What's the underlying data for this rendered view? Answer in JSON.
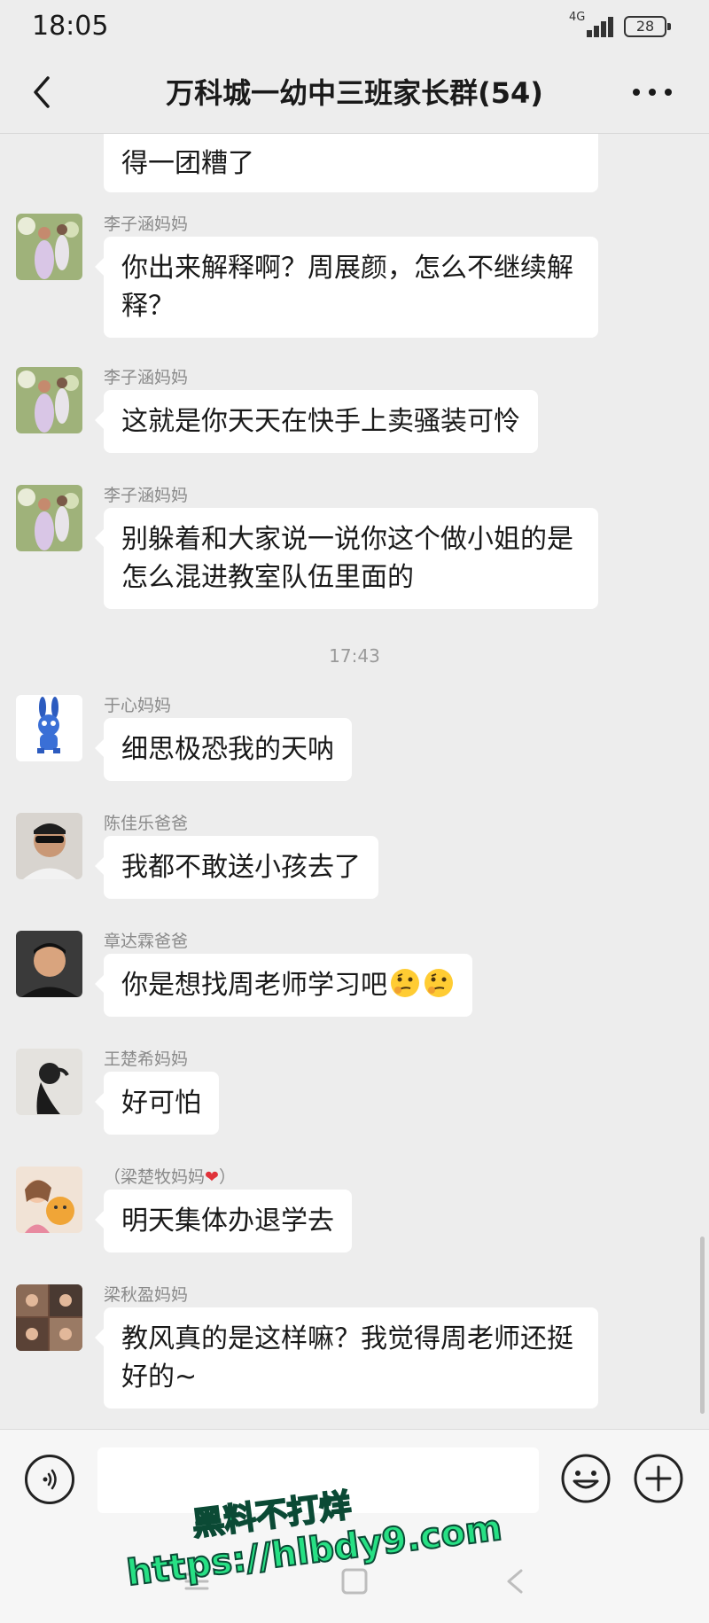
{
  "status_bar": {
    "time": "18:05",
    "network": "4G",
    "battery": "28"
  },
  "header": {
    "title": "万科城一幼中三班家长群(54)",
    "back_icon": "chevron-left-icon",
    "more_icon": "more-horizontal-icon"
  },
  "messages": [
    {
      "text": "得一团糟了"
    },
    {
      "sender": "李子涵妈妈",
      "text": "你出来解释啊？周展颜，怎么不继续解释？"
    },
    {
      "sender": "李子涵妈妈",
      "text": "这就是你天天在快手上卖骚装可怜"
    },
    {
      "sender": "李子涵妈妈",
      "text": "别躲着和大家说一说你这个做小姐的是怎么混进教室队伍里面的"
    },
    {
      "timestamp": "17:43"
    },
    {
      "sender": "于心妈妈",
      "text": "细思极恐我的天呐"
    },
    {
      "sender": "陈佳乐爸爸",
      "text": "我都不敢送小孩去了"
    },
    {
      "sender": "章达霖爸爸",
      "text": "你是想找周老师学习吧",
      "emoji": "thinking-face-icon"
    },
    {
      "sender": "王楚希妈妈",
      "text": "好可怕"
    },
    {
      "sender": "（梁楚牧妈妈",
      "sender_suffix": "）",
      "sender_emoji": "heart-icon",
      "text": "明天集体办退学去"
    },
    {
      "sender": "梁秋盈妈妈",
      "text": "教风真的是这样嘛？我觉得周老师还挺好的~"
    }
  ],
  "input_bar": {
    "voice_icon": "voice-icon",
    "input_value": "",
    "emoji_icon": "smiley-icon",
    "plus_icon": "plus-circle-icon"
  },
  "nav_bar": {
    "icons": [
      "menu-icon",
      "home-square-icon",
      "back-triangle-icon"
    ]
  },
  "watermark": {
    "line1": "黑料不打烊",
    "line2": "https://hlbdy9.com"
  },
  "colors": {
    "background": "#ededed",
    "bubble": "#ffffff",
    "sender_name": "#8a8a8a",
    "watermark_green": "#27e084"
  }
}
